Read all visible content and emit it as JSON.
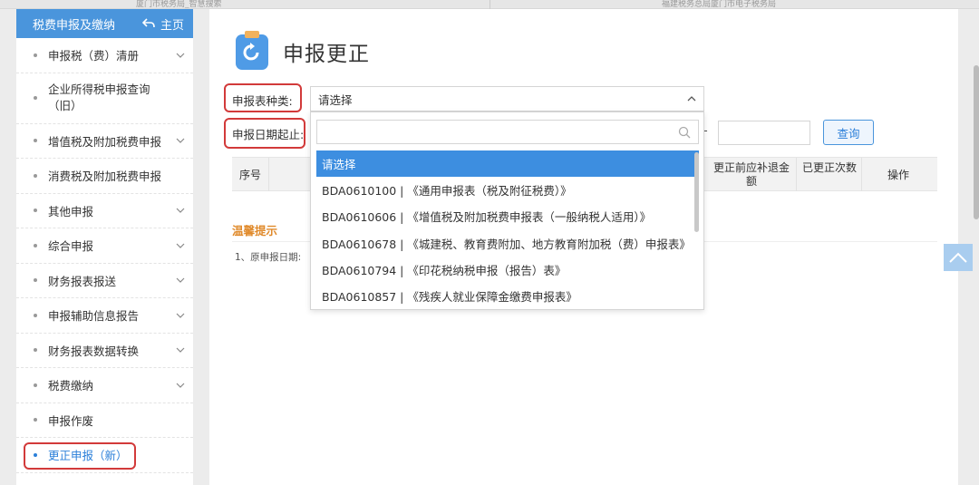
{
  "browser_tabs": [
    "厦门市税务局_智慧搜索",
    "福建税务总局厦门市电子税务局"
  ],
  "sidebar": {
    "title": "税费申报及缴纳",
    "home_label": "主页",
    "items": [
      {
        "label": "申报税（费）清册",
        "expandable": true
      },
      {
        "label": "企业所得税申报查询（旧）",
        "expandable": false
      },
      {
        "label": "增值税及附加税费申报",
        "expandable": true
      },
      {
        "label": "消费税及附加税费申报",
        "expandable": false
      },
      {
        "label": "其他申报",
        "expandable": true
      },
      {
        "label": "综合申报",
        "expandable": true
      },
      {
        "label": "财务报表报送",
        "expandable": true
      },
      {
        "label": "申报辅助信息报告",
        "expandable": true
      },
      {
        "label": "财务报表数据转换",
        "expandable": true
      },
      {
        "label": "税费缴纳",
        "expandable": true
      },
      {
        "label": "申报作废",
        "expandable": false
      },
      {
        "label": "更正申报（新）",
        "expandable": false,
        "active": true
      }
    ]
  },
  "page": {
    "title": "申报更正",
    "form_type_label": "申报表种类:",
    "form_type_value": "请选择",
    "date_range_label": "申报日期起止:",
    "date_separator": "-",
    "query_button": "查询"
  },
  "table": {
    "columns": [
      "序号",
      "更正前应补退金额",
      "已更正次数",
      "操作"
    ]
  },
  "tips": {
    "title": "温馨提示",
    "line1": "1、原申报日期:"
  },
  "dropdown": {
    "options": [
      "请选择",
      "BDA0610100 | 《通用申报表（税及附征税费）》",
      "BDA0610606 | 《增值税及附加税费申报表（一般纳税人适用）》",
      "BDA0610678 | 《城建税、教育费附加、地方教育附加税（费）申报表》",
      "BDA0610794 | 《印花税纳税申报（报告）表》",
      "BDA0610857 | 《残疾人就业保障金缴费申报表》"
    ],
    "selected_index": 0
  },
  "colors": {
    "accent": "#4a95dc",
    "highlight_red": "#d23a3a",
    "tips_orange": "#e08a2b"
  }
}
